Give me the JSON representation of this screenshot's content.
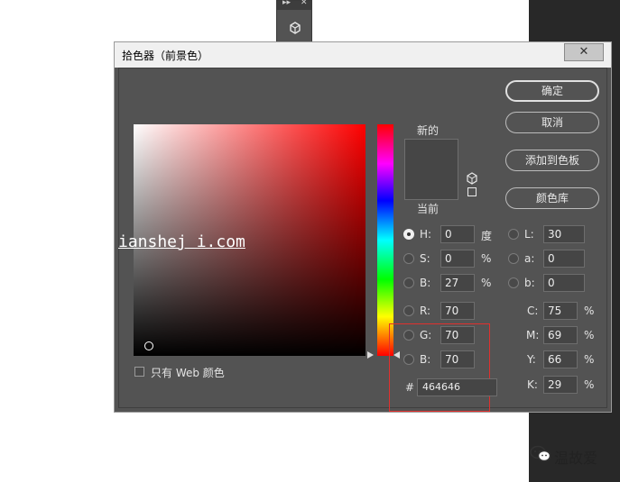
{
  "panel": {
    "arrows": "▸▸",
    "close": "✕"
  },
  "dialog": {
    "title": "拾色器（前景色）",
    "close": "✕",
    "labels": {
      "new": "新的",
      "current": "当前"
    },
    "buttons": {
      "ok": "确定",
      "cancel": "取消",
      "add_swatch": "添加到色板",
      "libraries": "颜色库"
    },
    "current_color": "#464646",
    "hsb": {
      "h": {
        "label": "H:",
        "value": "0",
        "unit": "度"
      },
      "s": {
        "label": "S:",
        "value": "0",
        "unit": "%"
      },
      "b": {
        "label": "B:",
        "value": "27",
        "unit": "%"
      }
    },
    "rgb": {
      "r": {
        "label": "R:",
        "value": "70"
      },
      "g": {
        "label": "G:",
        "value": "70"
      },
      "b": {
        "label": "B:",
        "value": "70"
      }
    },
    "lab": {
      "l": {
        "label": "L:",
        "value": "30"
      },
      "a": {
        "label": "a:",
        "value": "0"
      },
      "b": {
        "label": "b:",
        "value": "0"
      }
    },
    "cmyk": {
      "c": {
        "label": "C:",
        "value": "75",
        "unit": "%"
      },
      "m": {
        "label": "M:",
        "value": "69",
        "unit": "%"
      },
      "y": {
        "label": "Y:",
        "value": "66",
        "unit": "%"
      },
      "k": {
        "label": "K:",
        "value": "29",
        "unit": "%"
      }
    },
    "hex": {
      "label": "#",
      "value": "464646"
    },
    "web_only": "只有 Web 颜色",
    "selected_radio": "H"
  },
  "watermark": "ianshej i.com",
  "brand": {
    "name": "温故爱",
    "icon": "wechat-icon"
  }
}
